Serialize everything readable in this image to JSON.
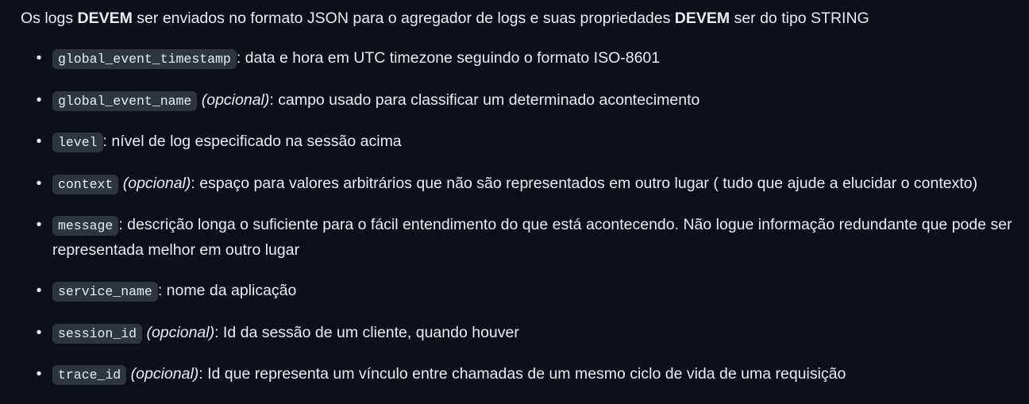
{
  "intro": {
    "part1": "Os logs ",
    "strong1": "DEVEM",
    "part2": " ser enviados no formato JSON para o agregador de logs e suas propriedades ",
    "strong2": "DEVEM",
    "part3": " ser do tipo STRING"
  },
  "bullet_char": "•",
  "items": [
    {
      "code": "global_event_timestamp",
      "optional": "",
      "desc": ": data e hora em UTC timezone seguindo o formato ISO-8601"
    },
    {
      "code": "global_event_name",
      "optional": "(opcional)",
      "desc": ": campo usado para classificar um determinado acontecimento"
    },
    {
      "code": "level",
      "optional": "",
      "desc": ": nível de log especificado na sessão acima"
    },
    {
      "code": "context",
      "optional": "(opcional)",
      "desc": ": espaço para valores arbitrários que não são representados em outro lugar ( tudo que ajude a elucidar o contexto)"
    },
    {
      "code": "message",
      "optional": "",
      "desc": ": descrição longa o suficiente para o fácil entendimento do que está acontecendo. Não logue informação redundante que pode ser representada melhor em outro lugar"
    },
    {
      "code": "service_name",
      "optional": "",
      "desc": ": nome da aplicação"
    },
    {
      "code": "session_id",
      "optional": "(opcional)",
      "desc": ": Id da sessão de um cliente, quando houver"
    },
    {
      "code": "trace_id",
      "optional": "(opcional)",
      "desc": ": Id que representa um vínculo entre chamadas de um mesmo ciclo de vida de uma requisição"
    }
  ]
}
